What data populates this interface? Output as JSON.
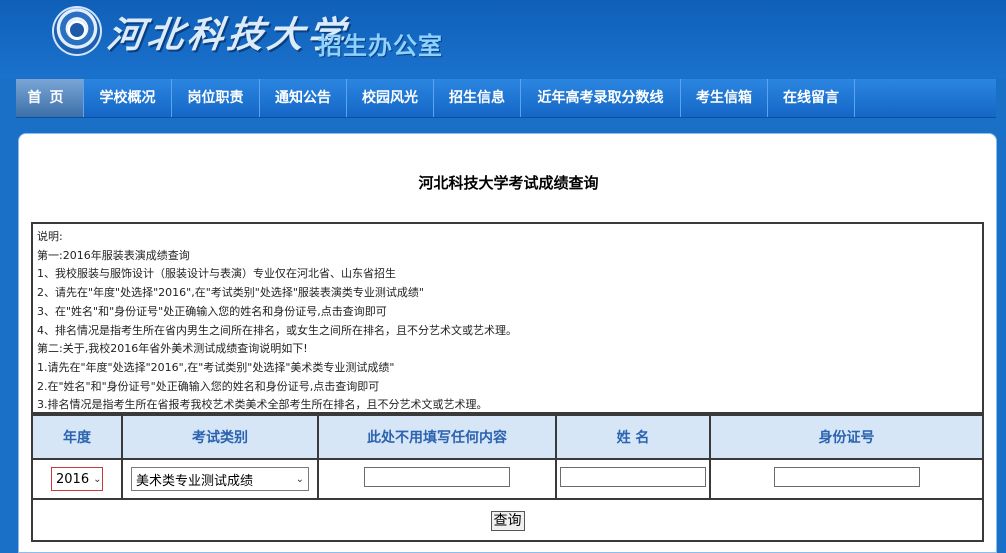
{
  "header": {
    "university_name": "河北科技大学",
    "office_name": "招生办公室"
  },
  "nav": {
    "items": [
      {
        "label": "首页"
      },
      {
        "label": "学校概况"
      },
      {
        "label": "岗位职责"
      },
      {
        "label": "通知公告"
      },
      {
        "label": "校园风光"
      },
      {
        "label": "招生信息"
      },
      {
        "label": "近年高考录取分数线"
      },
      {
        "label": "考生信箱"
      },
      {
        "label": "在线留言"
      }
    ]
  },
  "page": {
    "title": "河北科技大学考试成绩查询"
  },
  "notes": [
    " 说明:",
    "第一:2016年服装表演成绩查询",
    "1、我校服装与服饰设计（服装设计与表演）专业仅在河北省、山东省招生",
    "2、请先在\"年度\"处选择\"2016\",在\"考试类别\"处选择\"服装表演类专业测试成绩\"",
    "3、在\"姓名\"和\"身份证号\"处正确输入您的姓名和身份证号,点击查询即可",
    "4、排名情况是指考生所在省内男生之间所在排名，或女生之间所在排名，且不分艺术文或艺术理。",
    "第二:关于,我校2016年省外美术测试成绩查询说明如下!",
    "1.请先在\"年度\"处选择\"2016\",在\"考试类别\"处选择\"美术类专业测试成绩\"",
    "2.在\"姓名\"和\"身份证号\"处正确输入您的姓名和身份证号,点击查询即可",
    "3.排名情况是指考生所在省报考我校艺术类美术全部考生所在排名，且不分艺术文或艺术理。"
  ],
  "form": {
    "headers": {
      "year": "年度",
      "exam_type": "考试类别",
      "blank_field": "此处不用填写任何内容",
      "name": "姓 名",
      "id_number": "身份证号"
    },
    "year_selected": "2016",
    "exam_type_selected": "美术类专业测试成绩",
    "blank_value": "",
    "name_value": "",
    "id_value": "",
    "query_button": "查询"
  }
}
